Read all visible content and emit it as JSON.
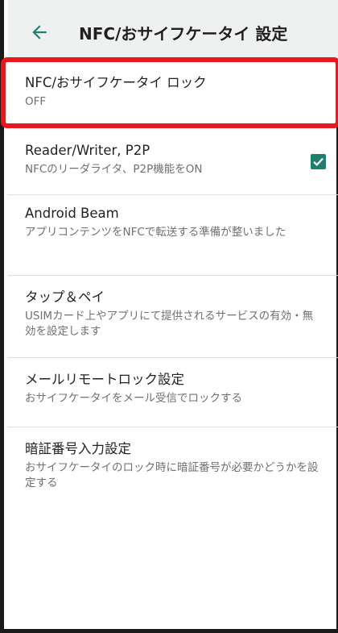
{
  "header": {
    "title": "NFC/おサイフケータイ 設定",
    "back_icon": "arrow-left-icon"
  },
  "settings": [
    {
      "title": "NFC/おサイフケータイ ロック",
      "summary": "OFF"
    },
    {
      "title": "Reader/Writer, P2P",
      "summary": "NFCのリーダライタ、P2P機能をON",
      "checked": true
    },
    {
      "title": "Android Beam",
      "summary": "アプリコンテンツをNFCで転送する準備が整いました"
    },
    {
      "title": "タップ＆ペイ",
      "summary": "USIMカード上やアプリにて提供されるサービスの有効・無効を設定します"
    },
    {
      "title": "メールリモートロック設定",
      "summary": "おサイフケータイをメール受信でロックする"
    },
    {
      "title": "暗証番号入力設定",
      "summary": "おサイフケータイのロック時に暗証番号が必要かどうかを設定する"
    }
  ],
  "colors": {
    "accent": "#1e7f6e",
    "highlight": "#e8181c",
    "appbar": "#eef1ef"
  }
}
